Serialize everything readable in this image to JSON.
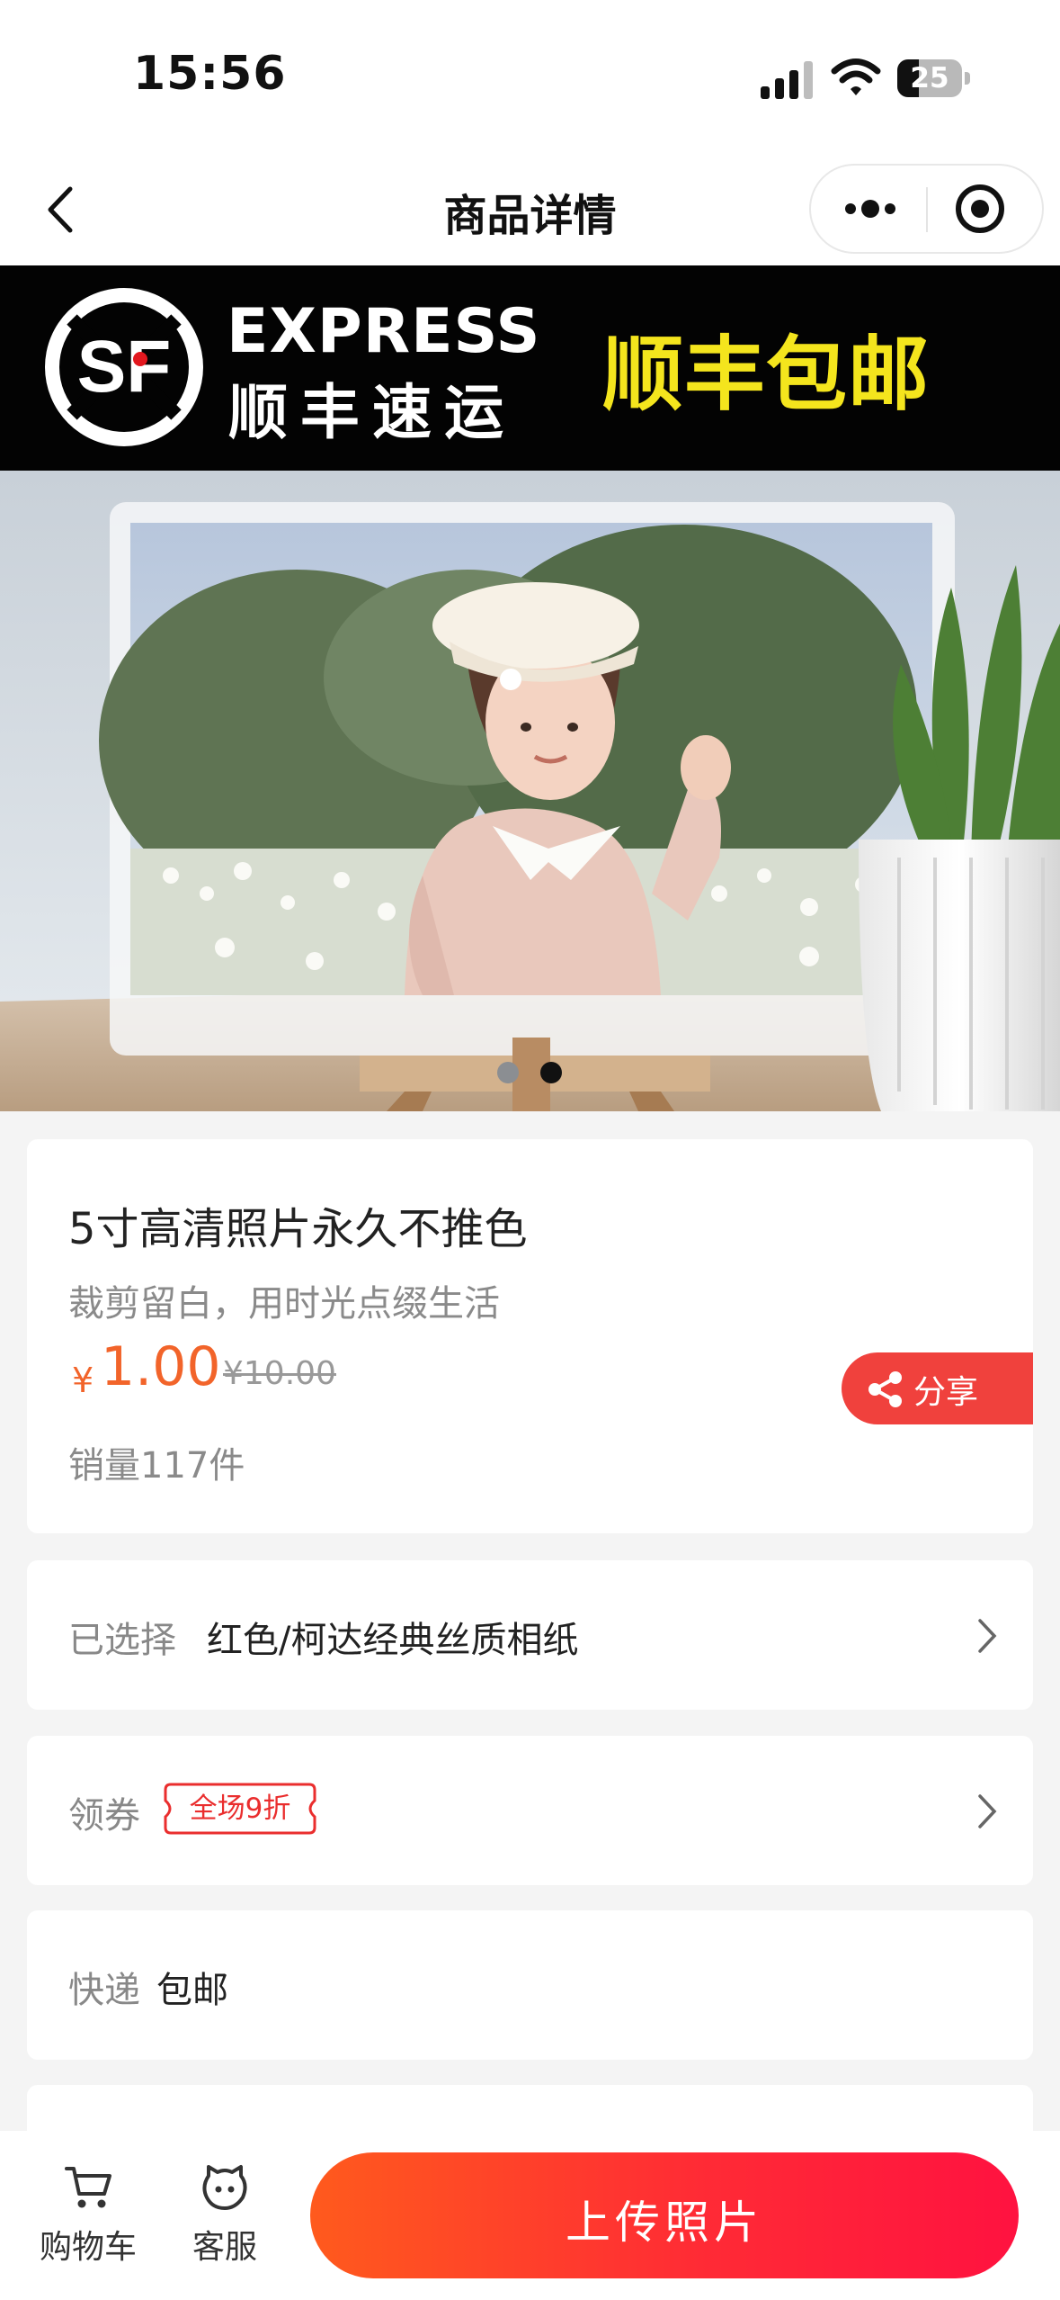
{
  "status_bar": {
    "time": "15:56",
    "battery": "25"
  },
  "nav": {
    "title": "商品详情"
  },
  "banner": {
    "sf_brand": "EXPRESS",
    "sf_cn": "顺丰速运",
    "slogan": "顺丰包邮",
    "current_slide": 2,
    "total_slides": 2
  },
  "product": {
    "title": "5寸高清照片永久不推色",
    "subtitle": "裁剪留白，用时光点缀生活",
    "currency": "¥",
    "price": "1.00",
    "original_price": "¥10.00",
    "sales": "销量117件",
    "share_label": "分享"
  },
  "options": {
    "selected_label": "已选择",
    "selected_value": "红色/柯达经典丝质相纸",
    "coupon_label": "领券",
    "coupon_badge": "全场9折",
    "delivery_label": "快递",
    "delivery_value": "包邮"
  },
  "bottom": {
    "cart_label": "购物车",
    "service_label": "客服",
    "upload_label": "上传照片"
  },
  "colors": {
    "accent": "#f2642a",
    "share": "#f0413d",
    "slogan": "#f4e51d",
    "coupon": "#ea2e2e"
  }
}
